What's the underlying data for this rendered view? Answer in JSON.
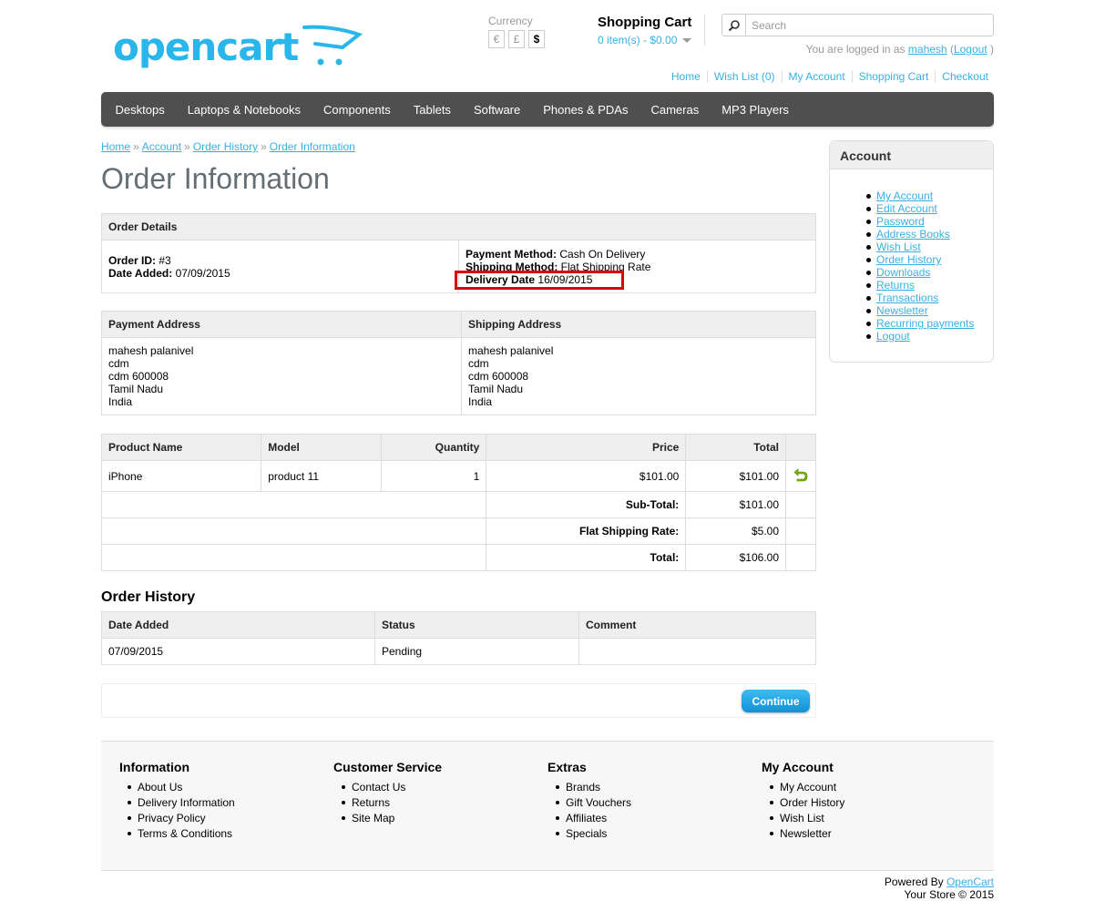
{
  "header": {
    "logo_text": "opencart",
    "currency": {
      "label": "Currency",
      "options": [
        "€",
        "£",
        "$"
      ],
      "active": "$"
    },
    "cart": {
      "title": "Shopping Cart",
      "summary": "0 item(s) - $0.00"
    },
    "search": {
      "placeholder": "Search"
    },
    "welcome": {
      "prefix": "You are logged in as",
      "user": "mahesh",
      "open": "(",
      "logout": "Logout",
      "close": ")"
    },
    "links": [
      "Home",
      "Wish List (0)",
      "My Account",
      "Shopping Cart",
      "Checkout"
    ]
  },
  "menu": [
    "Desktops",
    "Laptops & Notebooks",
    "Components",
    "Tablets",
    "Software",
    "Phones & PDAs",
    "Cameras",
    "MP3 Players"
  ],
  "breadcrumb": [
    "Home",
    "Account",
    "Order History",
    "Order Information"
  ],
  "breadcrumb_sep": "»",
  "page_title": "Order Information",
  "order_details": {
    "heading": "Order Details",
    "order_id_label": "Order ID:",
    "order_id": "#3",
    "date_added_label": "Date Added:",
    "date_added": "07/09/2015",
    "payment_method_label": "Payment Method:",
    "payment_method": "Cash On Delivery",
    "shipping_method_label": "Shipping Method:",
    "shipping_method": "Flat Shipping Rate",
    "delivery_date_label": "Delivery Date",
    "delivery_date": "16/09/2015"
  },
  "addresses": {
    "payment_heading": "Payment Address",
    "shipping_heading": "Shipping Address",
    "payment": [
      "mahesh palanivel",
      "cdm",
      "cdm 600008",
      "Tamil Nadu",
      "India"
    ],
    "shipping": [
      "mahesh palanivel",
      "cdm",
      "cdm 600008",
      "Tamil Nadu",
      "India"
    ]
  },
  "products": {
    "headers": {
      "name": "Product Name",
      "model": "Model",
      "quantity": "Quantity",
      "price": "Price",
      "total": "Total"
    },
    "rows": [
      {
        "name": "iPhone",
        "model": "product 11",
        "quantity": "1",
        "price": "$101.00",
        "total": "$101.00"
      }
    ],
    "totals": [
      {
        "label": "Sub-Total:",
        "value": "$101.00"
      },
      {
        "label": "Flat Shipping Rate:",
        "value": "$5.00"
      },
      {
        "label": "Total:",
        "value": "$106.00"
      }
    ]
  },
  "history": {
    "title": "Order History",
    "headers": {
      "date": "Date Added",
      "status": "Status",
      "comment": "Comment"
    },
    "rows": [
      {
        "date": "07/09/2015",
        "status": "Pending",
        "comment": ""
      }
    ]
  },
  "continue_label": "Continue",
  "account_box": {
    "title": "Account",
    "items": [
      "My Account",
      "Edit Account",
      "Password",
      "Address Books",
      "Wish List",
      "Order History",
      "Downloads",
      "Returns",
      "Transactions",
      "Newsletter",
      "Recurring payments",
      "Logout"
    ]
  },
  "footer": {
    "columns": [
      {
        "title": "Information",
        "items": [
          "About Us",
          "Delivery Information",
          "Privacy Policy",
          "Terms & Conditions"
        ]
      },
      {
        "title": "Customer Service",
        "items": [
          "Contact Us",
          "Returns",
          "Site Map"
        ]
      },
      {
        "title": "Extras",
        "items": [
          "Brands",
          "Gift Vouchers",
          "Affiliates",
          "Specials"
        ]
      },
      {
        "title": "My Account",
        "items": [
          "My Account",
          "Order History",
          "Wish List",
          "Newsletter"
        ]
      }
    ],
    "powered_prefix": "Powered By",
    "powered_link": "OpenCart",
    "copyright": "Your Store © 2015"
  },
  "colors": {
    "link": "#38B0E3",
    "menu_bg": "#4f4f4f",
    "button": "#1ba7e1",
    "highlight": "#e00000",
    "return_icon": "#7ab800"
  }
}
